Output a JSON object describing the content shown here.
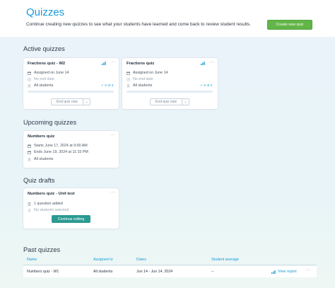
{
  "header": {
    "title": "Quizzes",
    "subtitle": "Continue creating new quizzes to see what your students have learned and come back to review student results.",
    "create_button": "Create new quiz"
  },
  "active": {
    "title": "Active quizzes",
    "cards": [
      {
        "title": "Fractions quiz - W2",
        "assigned": "Assigned on June 14",
        "end_date": "No end date",
        "students": "All students",
        "progress": "0 of 2",
        "progress_fraction": 0,
        "end_button": "End quiz now"
      },
      {
        "title": "Fractions quiz",
        "assigned": "Assigned on June 14",
        "end_date": "No end date",
        "students": "All students",
        "progress": "0 of 2",
        "progress_fraction": 0,
        "end_button": "End quiz now"
      }
    ]
  },
  "upcoming": {
    "title": "Upcoming quizzes",
    "card": {
      "title": "Numbers quiz",
      "starts": "Starts June 17, 2024 at 9:00 AM",
      "ends": "Ends June 19, 2024 at 11:15 PM",
      "students": "All students"
    }
  },
  "drafts": {
    "title": "Quiz drafts",
    "card": {
      "title": "Numbers quiz - Unit test",
      "questions": "1 question added",
      "students": "No students selected",
      "continue_button": "Continue editing"
    }
  },
  "past": {
    "title": "Past quizzes",
    "columns": [
      "Name",
      "Assigned to",
      "Dates",
      "Student average"
    ],
    "rows": [
      {
        "name": "Numbers quiz - W1",
        "assigned_to": "All students",
        "dates": "Jun 14 - Jun 14, 2024",
        "average": "--",
        "view_report": "View report"
      }
    ]
  },
  "icons": {
    "more": "more-dots-icon",
    "chart": "bar-chart-icon",
    "calendar": "calendar-icon",
    "clock": "clock-icon",
    "user": "user-icon",
    "document": "document-icon"
  },
  "colors": {
    "title": "#1a9ad6",
    "create_button": "#62b548",
    "continue_button": "#2b9a92",
    "link": "#1a9ad6"
  }
}
